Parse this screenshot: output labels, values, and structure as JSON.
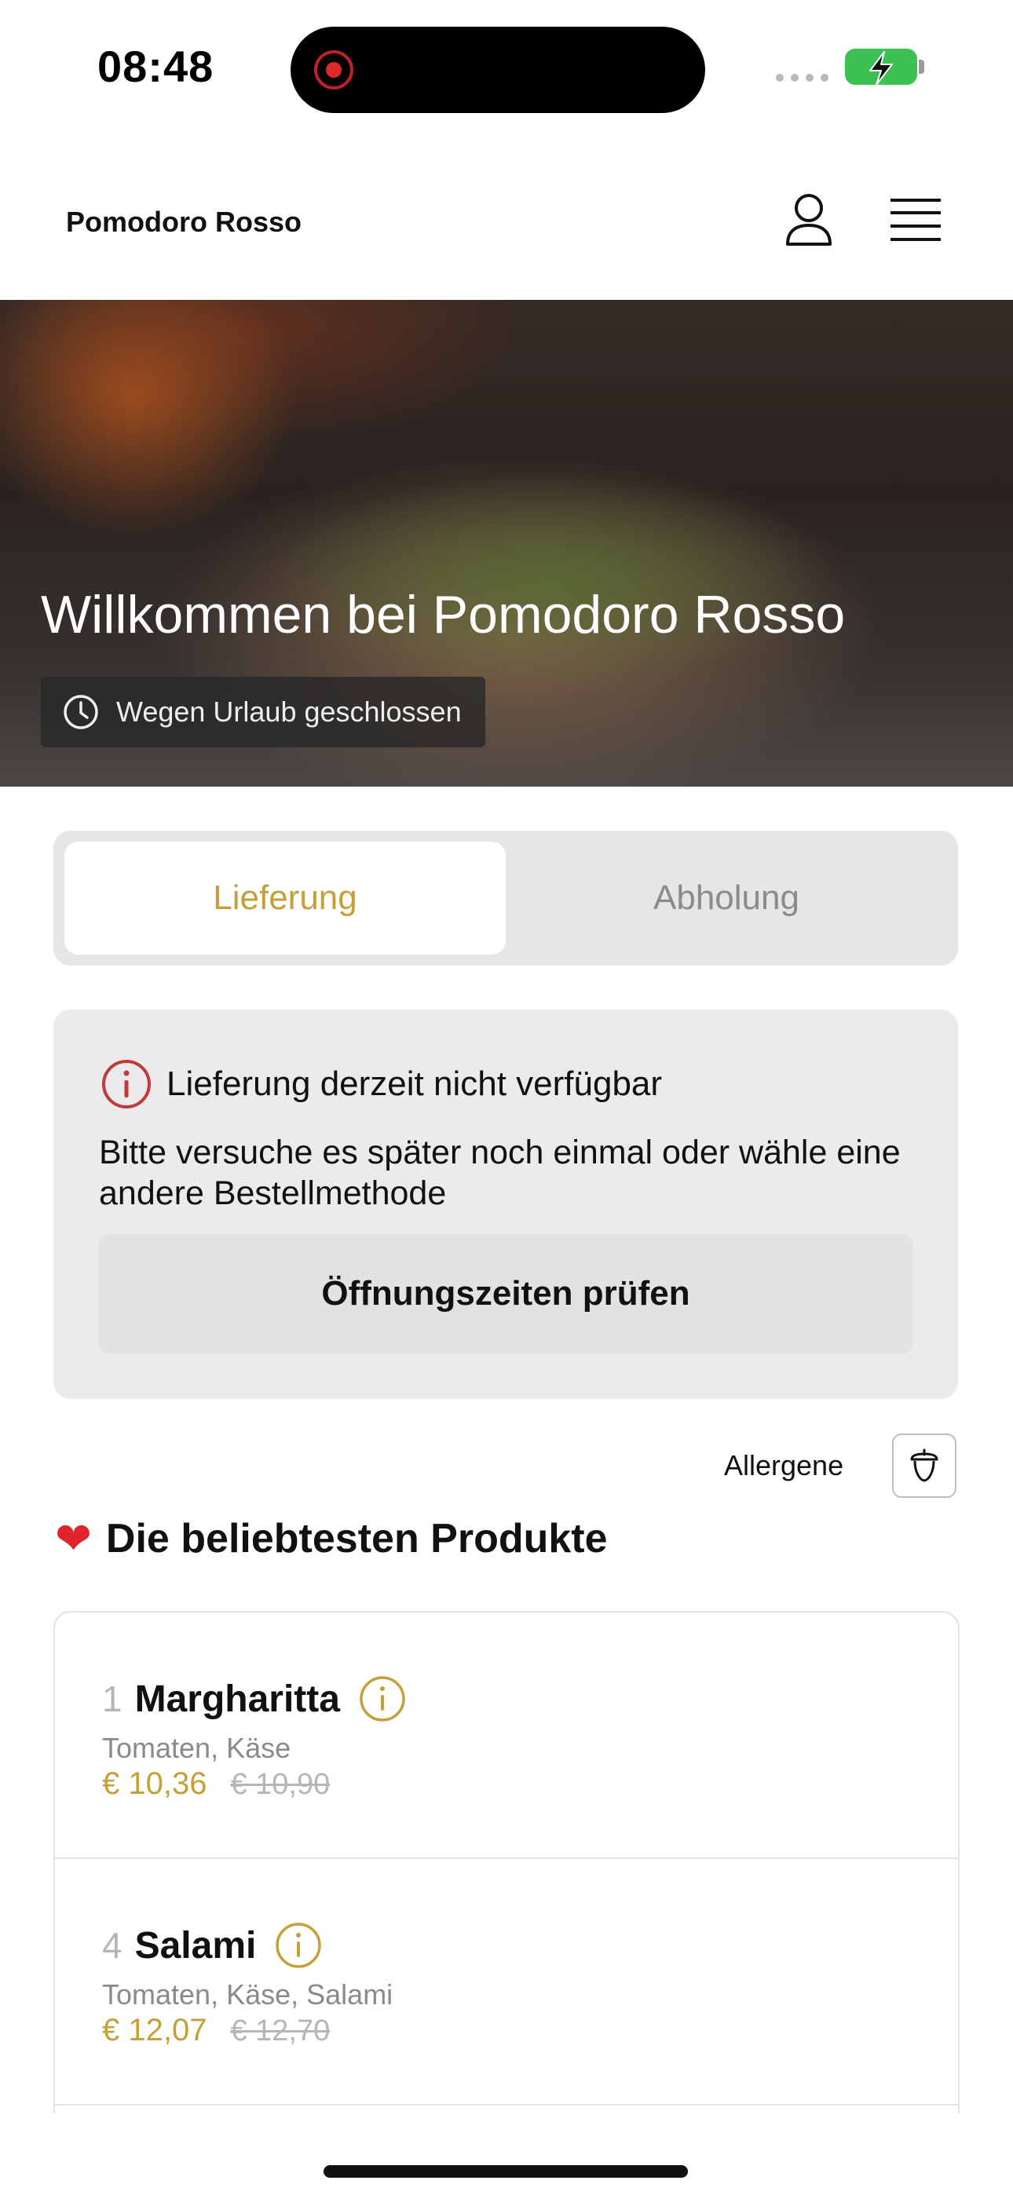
{
  "status_bar": {
    "time": "08:48",
    "icons": [
      "screen-recording-icon",
      "cellular-signal-icon",
      "battery-charging-icon"
    ],
    "battery_color": "#3cc153"
  },
  "header": {
    "brand": "Pomodoro Rosso",
    "icons": [
      "user-icon",
      "menu-icon"
    ]
  },
  "hero": {
    "title": "Willkommen bei Pomodoro Rosso",
    "status": "Wegen Urlaub geschlossen",
    "status_icon": "clock-icon"
  },
  "mode_toggle": {
    "options": [
      "Lieferung",
      "Abholung"
    ],
    "selected": "Lieferung"
  },
  "notice": {
    "icon": "info-circle-icon",
    "title": "Lieferung derzeit nicht verfügbar",
    "body": "Bitte versuche es später noch einmal oder wähle eine andere Bestellmethode",
    "button": "Öffnungszeiten prüfen"
  },
  "allergens": {
    "label": "Allergene",
    "icon": "acorn-icon"
  },
  "popular": {
    "icon": "heart-icon",
    "heart_glyph": "❤",
    "title": "Die beliebtesten Produkte",
    "products": [
      {
        "number": "1",
        "name": "Margharitta",
        "description": "Tomaten, Käse",
        "price": "€ 10,36",
        "old_price": "€ 10,90"
      },
      {
        "number": "4",
        "name": "Salami",
        "description": "Tomaten, Käse, Salami",
        "price": "€ 12,07",
        "old_price": "€ 12,70"
      }
    ]
  },
  "colors": {
    "accent": "#c4a03a",
    "alert": "#c0393b",
    "heart": "#e0242b"
  }
}
